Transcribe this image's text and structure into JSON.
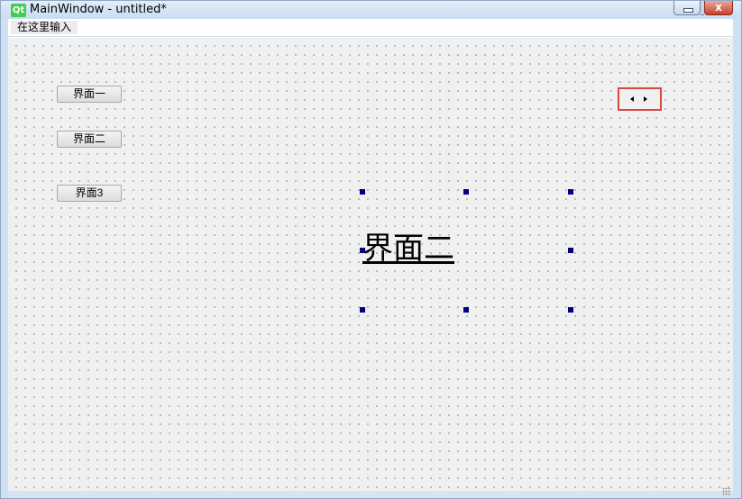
{
  "window": {
    "title": "MainWindow - untitled*",
    "logo_text": "Qt",
    "close_glyph": "x"
  },
  "menubar": {
    "entry_placeholder": "在这里输入"
  },
  "buttons": [
    {
      "label": "界面一"
    },
    {
      "label": "界面二"
    },
    {
      "label": "界面3"
    }
  ],
  "selected_label": {
    "text": "界面二"
  },
  "arrow_widget": {
    "left_icon": "arrow-left-icon",
    "right_icon": "arrow-right-icon",
    "highlight_color": "#d9453f"
  },
  "colors": {
    "qt_green": "#41cd52",
    "handle": "#000080",
    "canvas": "#f0f0f0"
  }
}
